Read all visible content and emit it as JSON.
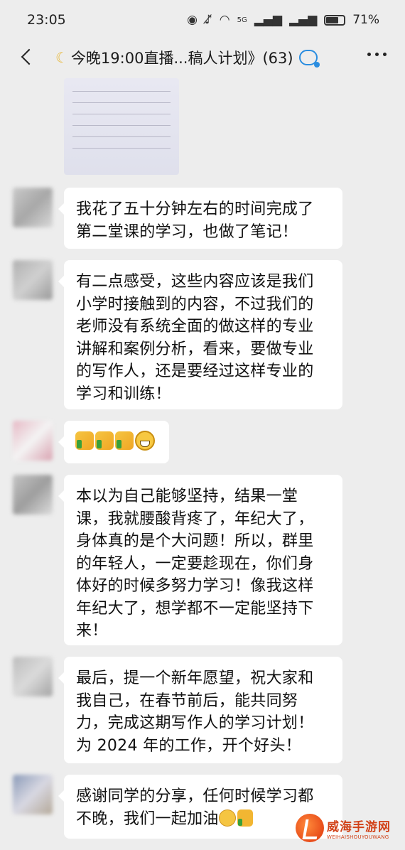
{
  "status_bar": {
    "time": "23:05",
    "network": "5G",
    "battery_percent": "71%",
    "battery_level": 0.71
  },
  "header": {
    "title": "今晚19:00直播...稿人计划》(63)",
    "icons": [
      "back-icon",
      "moon-icon",
      "chat-icon",
      "more-icon"
    ]
  },
  "messages": [
    {
      "type": "image",
      "sender": "blurred-avatar"
    },
    {
      "type": "text",
      "text": "我花了五十分钟左右的时间完成了\n第二堂课的学习，也做了笔记！"
    },
    {
      "type": "text",
      "text": "有二点感受，这些内容应该是我们\n小学时接触到的内容，不过我们的\n老师没有系统全面的做这样的专业\n讲解和案例分析，看来，要做专业\n的写作人，还是要经过这样专业的\n学习和训练！"
    },
    {
      "type": "emoji",
      "emoji": [
        "thumbs-up-icon",
        "thumbs-up-icon",
        "thumbs-up-icon",
        "grinning-face-icon"
      ]
    },
    {
      "type": "text",
      "text": "本以为自己能够坚持，结果一堂\n课，我就腰酸背疼了，年纪大了，\n身体真的是个大问题！所以，群里\n的年轻人，一定要趁现在，你们身\n体好的时候多努力学习！像我这样\n年纪大了，想学都不一定能坚持下\n来！"
    },
    {
      "type": "text",
      "text": "最后，提一个新年愿望，祝大家和\n我自己，在春节前后，能共同努\n力，完成这期写作人的学习计划！\n为 2024 年的工作，开个好头！"
    },
    {
      "type": "text",
      "text": "感谢同学的分享，任何时候学习都\n不晚，我们一起加油"
    }
  ],
  "watermark": {
    "main": "威海手游网",
    "sub": "WEIHAISHOUYOUWANG"
  },
  "colors": {
    "background": "#ededed",
    "bubble": "#ffffff",
    "title_icon": "#2a8de0",
    "watermark": "#d2431a"
  }
}
